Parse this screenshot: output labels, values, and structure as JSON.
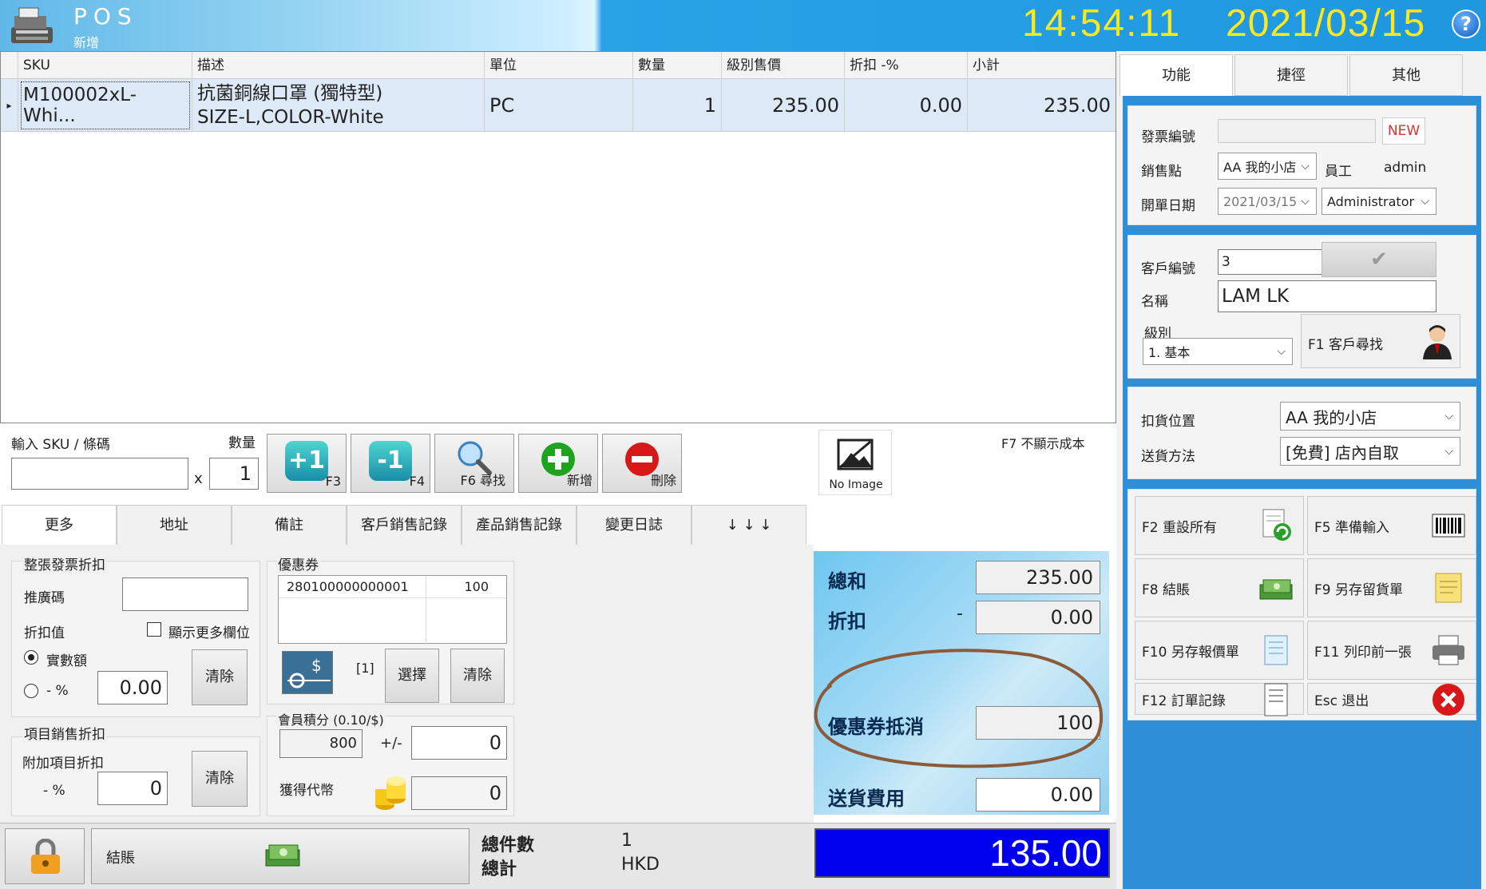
{
  "header": {
    "title": "POS",
    "subtitle": "新增",
    "time": "14:54:11",
    "date": "2021/03/15",
    "help": "?"
  },
  "grid": {
    "columns": [
      "SKU",
      "描述",
      "單位",
      "數量",
      "級別售價",
      "折扣 -%",
      "小計"
    ],
    "rows": [
      {
        "sku": "M100002xL-Whi...",
        "desc1": "抗菌銅線口罩 (獨特型)",
        "desc2": "SIZE-L,COLOR-White",
        "unit": "PC",
        "qty": "1",
        "price": "235.00",
        "discount": "0.00",
        "subtotal": "235.00"
      }
    ]
  },
  "entry": {
    "sku_label": "輸入 SKU / 條碼",
    "qty_label": "數量",
    "x": "x",
    "qty_value": "1",
    "btn_plus": "+1",
    "btn_plus_key": "F3",
    "btn_minus": "-1",
    "btn_minus_key": "F4",
    "btn_search": "F6 尋找",
    "btn_add": "新增",
    "btn_delete": "刪除",
    "no_image": "No Image",
    "cost_toggle": "F7 不顯示成本"
  },
  "tabs": [
    "更多",
    "地址",
    "備註",
    "客戶銷售記錄",
    "產品銷售記錄",
    "變更日誌",
    "↓ ↓ ↓"
  ],
  "more": {
    "invoice_discount_title": "整張發票折扣",
    "promo_code": "推廣碼",
    "discount_value": "折扣值",
    "show_more": "顯示更多欄位",
    "amount": "實數額",
    "percent": "- %",
    "discount_input": "0.00",
    "clear": "清除",
    "item_discount_title": "項目銷售折扣",
    "extra_item_discount": "附加項目折扣",
    "item_percent": "- %",
    "item_percent_value": "0",
    "clear2": "清除"
  },
  "coupon": {
    "title": "優惠券",
    "code": "280100000000001",
    "value": "100",
    "count": "[1]",
    "select": "選擇",
    "clear": "清除",
    "points_title": "會員積分 (0.10/$)",
    "points": "800",
    "plusminus": "+/-",
    "points_adj": "0",
    "tokens": "獲得代幣",
    "tokens_value": "0"
  },
  "totals": {
    "sum_label": "總和",
    "sum": "235.00",
    "disc_label": "折扣",
    "disc_sign": "-",
    "disc": "0.00",
    "coupon_label": "優惠券抵消",
    "coupon": "100",
    "ship_label": "送貨費用",
    "ship": "0.00",
    "grand": "135.00"
  },
  "bottom": {
    "checkout": "結賬",
    "count_label": "總件數",
    "count": "1",
    "total_label": "總計",
    "currency": "HKD"
  },
  "right": {
    "tabs": [
      "功能",
      "捷徑",
      "其他"
    ],
    "invoice_no": "發票編號",
    "new": "NEW",
    "shop": "銷售點",
    "shop_value": "AA 我的小店",
    "staff": "員工",
    "staff_value": "admin",
    "open_date": "開單日期",
    "open_date_value": "2021/03/15",
    "staff_select": "Administrator",
    "cust_no": "客戶編號",
    "cust_no_value": "3",
    "name": "名稱",
    "name_value": "LAM LK",
    "level": "級別",
    "level_value": "1. 基本",
    "cust_search": "F1  客戶尋找",
    "stock_loc": "扣貨位置",
    "stock_loc_value": "AA 我的小店",
    "delivery": "送貨方法",
    "delivery_value": "[免費] 店內自取",
    "fkeys": [
      {
        "label": "F2  重設所有"
      },
      {
        "label": "F5  準備輸入"
      },
      {
        "label": "F8  結賬"
      },
      {
        "label": "F9  另存留貨單"
      },
      {
        "label": "F10 另存報價單"
      },
      {
        "label": "F11  列印前一張"
      },
      {
        "label": "F12  訂單記錄"
      },
      {
        "label": "Esc  退出"
      }
    ]
  },
  "colors": {
    "clock": "#ffe81a",
    "grand_bg": "#0000ee",
    "annotation": "#8a5a3a"
  }
}
